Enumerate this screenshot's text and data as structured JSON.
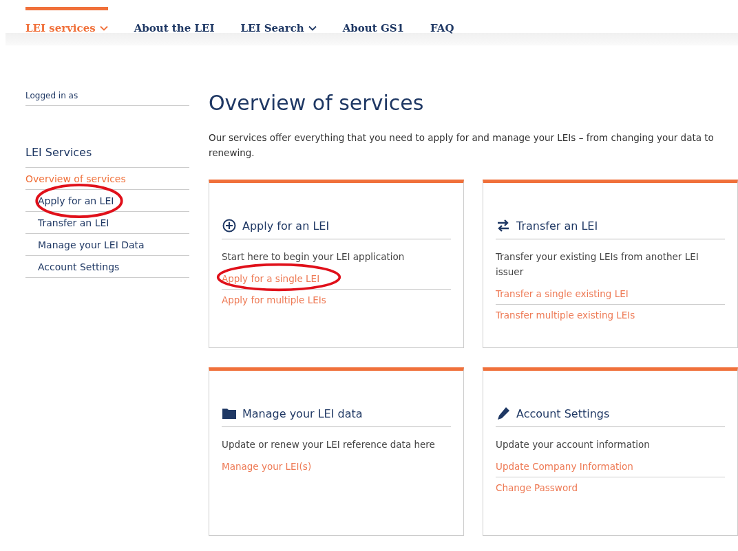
{
  "nav": [
    {
      "label": "LEI services",
      "dropdown": true,
      "selected": true
    },
    {
      "label": "About the LEI",
      "dropdown": false,
      "selected": false
    },
    {
      "label": "LEI Search",
      "dropdown": true,
      "selected": false
    },
    {
      "label": "About GS1",
      "dropdown": false,
      "selected": false
    },
    {
      "label": "FAQ",
      "dropdown": false,
      "selected": false
    }
  ],
  "sidebar": {
    "logged_in_label": "Logged in as",
    "heading": "LEI Services",
    "items": [
      {
        "label": "Overview of services",
        "selected": true,
        "circled": false,
        "sub": false
      },
      {
        "label": "Apply for an LEI",
        "selected": false,
        "circled": true,
        "sub": true
      },
      {
        "label": "Transfer an LEI",
        "selected": false,
        "circled": false,
        "sub": true
      },
      {
        "label": "Manage your LEI Data",
        "selected": false,
        "circled": false,
        "sub": true
      },
      {
        "label": "Account Settings",
        "selected": false,
        "circled": false,
        "sub": true
      }
    ]
  },
  "page": {
    "title": "Overview of services",
    "intro": "Our services offer everything that you need to apply for and manage your LEIs – from changing your data to renewing."
  },
  "cards": [
    {
      "kind": "plus",
      "title": "Apply for an LEI",
      "description": "Start here to begin your LEI application",
      "links": [
        {
          "label": "Apply for a single LEI",
          "circled": true
        },
        {
          "label": "Apply for multiple LEIs",
          "circled": false
        }
      ]
    },
    {
      "kind": "transfer",
      "title": "Transfer an LEI",
      "description": "Transfer your existing LEIs from another LEI issuer",
      "links": [
        {
          "label": "Transfer a single existing LEI",
          "circled": false
        },
        {
          "label": "Transfer multiple existing LEIs",
          "circled": false
        }
      ]
    },
    {
      "kind": "folder",
      "title": "Manage your LEI data",
      "description": "Update or renew your LEI reference data here",
      "links": [
        {
          "label": "Manage your LEI(s)",
          "circled": false
        }
      ]
    },
    {
      "kind": "pencil",
      "title": "Account Settings",
      "description": "Update your account information",
      "links": [
        {
          "label": "Update Company Information",
          "circled": false
        },
        {
          "label": "Change Password",
          "circled": false
        }
      ]
    }
  ]
}
